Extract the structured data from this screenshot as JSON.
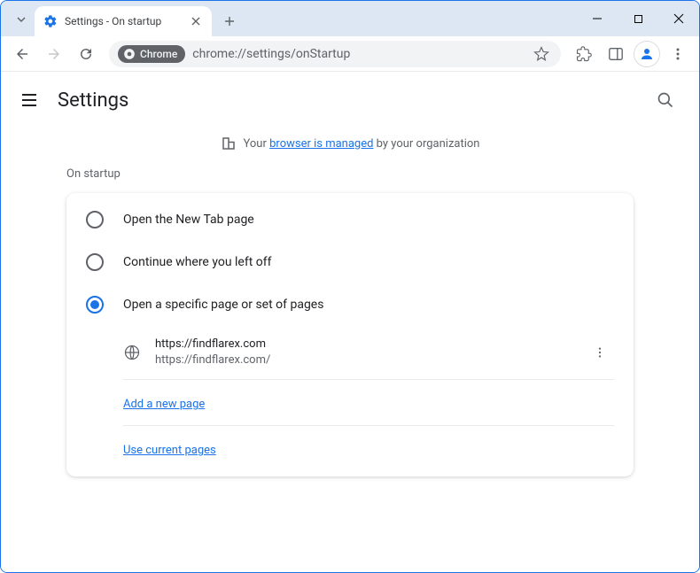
{
  "tab": {
    "title": "Settings - On startup"
  },
  "omnibox": {
    "chip": "Chrome",
    "url": "chrome://settings/onStartup"
  },
  "header": {
    "title": "Settings"
  },
  "banner": {
    "prefix": "Your ",
    "link": "browser is managed",
    "suffix": " by your organization"
  },
  "section": {
    "title": "On startup"
  },
  "options": {
    "newtab": "Open the New Tab page",
    "continue": "Continue where you left off",
    "specific": "Open a specific page or set of pages"
  },
  "page": {
    "primary": "https://findflarex.com",
    "secondary": "https://findflarex.com/"
  },
  "links": {
    "add": "Add a new page",
    "use": "Use current pages"
  }
}
